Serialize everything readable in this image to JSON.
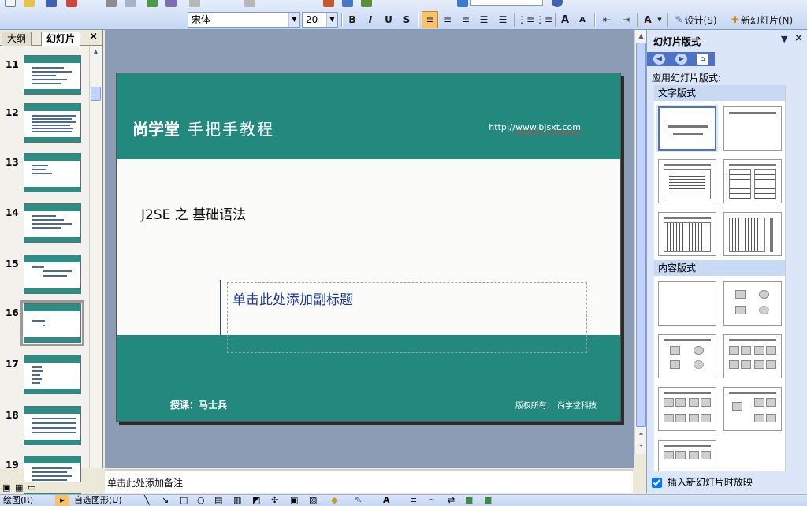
{
  "toolbar": {
    "font_name": "宋体",
    "font_size": "20",
    "bold": "B",
    "italic": "I",
    "underline": "U",
    "shadow": "S",
    "grow_font": "A",
    "shrink_font": "A",
    "font_color": "A",
    "design_label": "设计(S)",
    "new_slide_label": "新幻灯片(N)"
  },
  "left_pane": {
    "tab_outline": "大纲",
    "tab_slides": "幻灯片",
    "close": "×",
    "slides": [
      {
        "number": "11"
      },
      {
        "number": "12"
      },
      {
        "number": "13"
      },
      {
        "number": "14"
      },
      {
        "number": "15"
      },
      {
        "number": "16",
        "selected": true
      },
      {
        "number": "17"
      },
      {
        "number": "18"
      },
      {
        "number": "19"
      }
    ]
  },
  "slide": {
    "logo": "尚学堂",
    "logo_tagline": "手把手教程",
    "url_prefix": "http://",
    "url_link": "www.bjsxt.com",
    "title": "J2SE 之 基础语法",
    "subtitle_placeholder": "单击此处添加副标题",
    "footer_left": "授课：马士兵",
    "footer_right": "版权所有：  尚学堂科技"
  },
  "notes": {
    "placeholder": "单击此处添加备注"
  },
  "task_pane": {
    "title": "幻灯片版式",
    "dropdown": "▼",
    "close": "×",
    "apply_label": "应用幻灯片版式:",
    "section_text_layouts": "文字版式",
    "section_content_layouts": "内容版式",
    "show_when_inserting": "插入新幻灯片时放映"
  },
  "view_buttons": {
    "normal": "▣",
    "sorter": "▦",
    "show": "▭"
  },
  "draw_toolbar": {
    "draw_menu": "绘图(R)",
    "autoshapes": "自选图形(U)"
  },
  "colors": {
    "slide_teal": "#23887e",
    "subtitle_blue": "#1c3a95",
    "taskpane_bg": "#dbe6f9",
    "canvas_bg": "#8c9cb4"
  }
}
